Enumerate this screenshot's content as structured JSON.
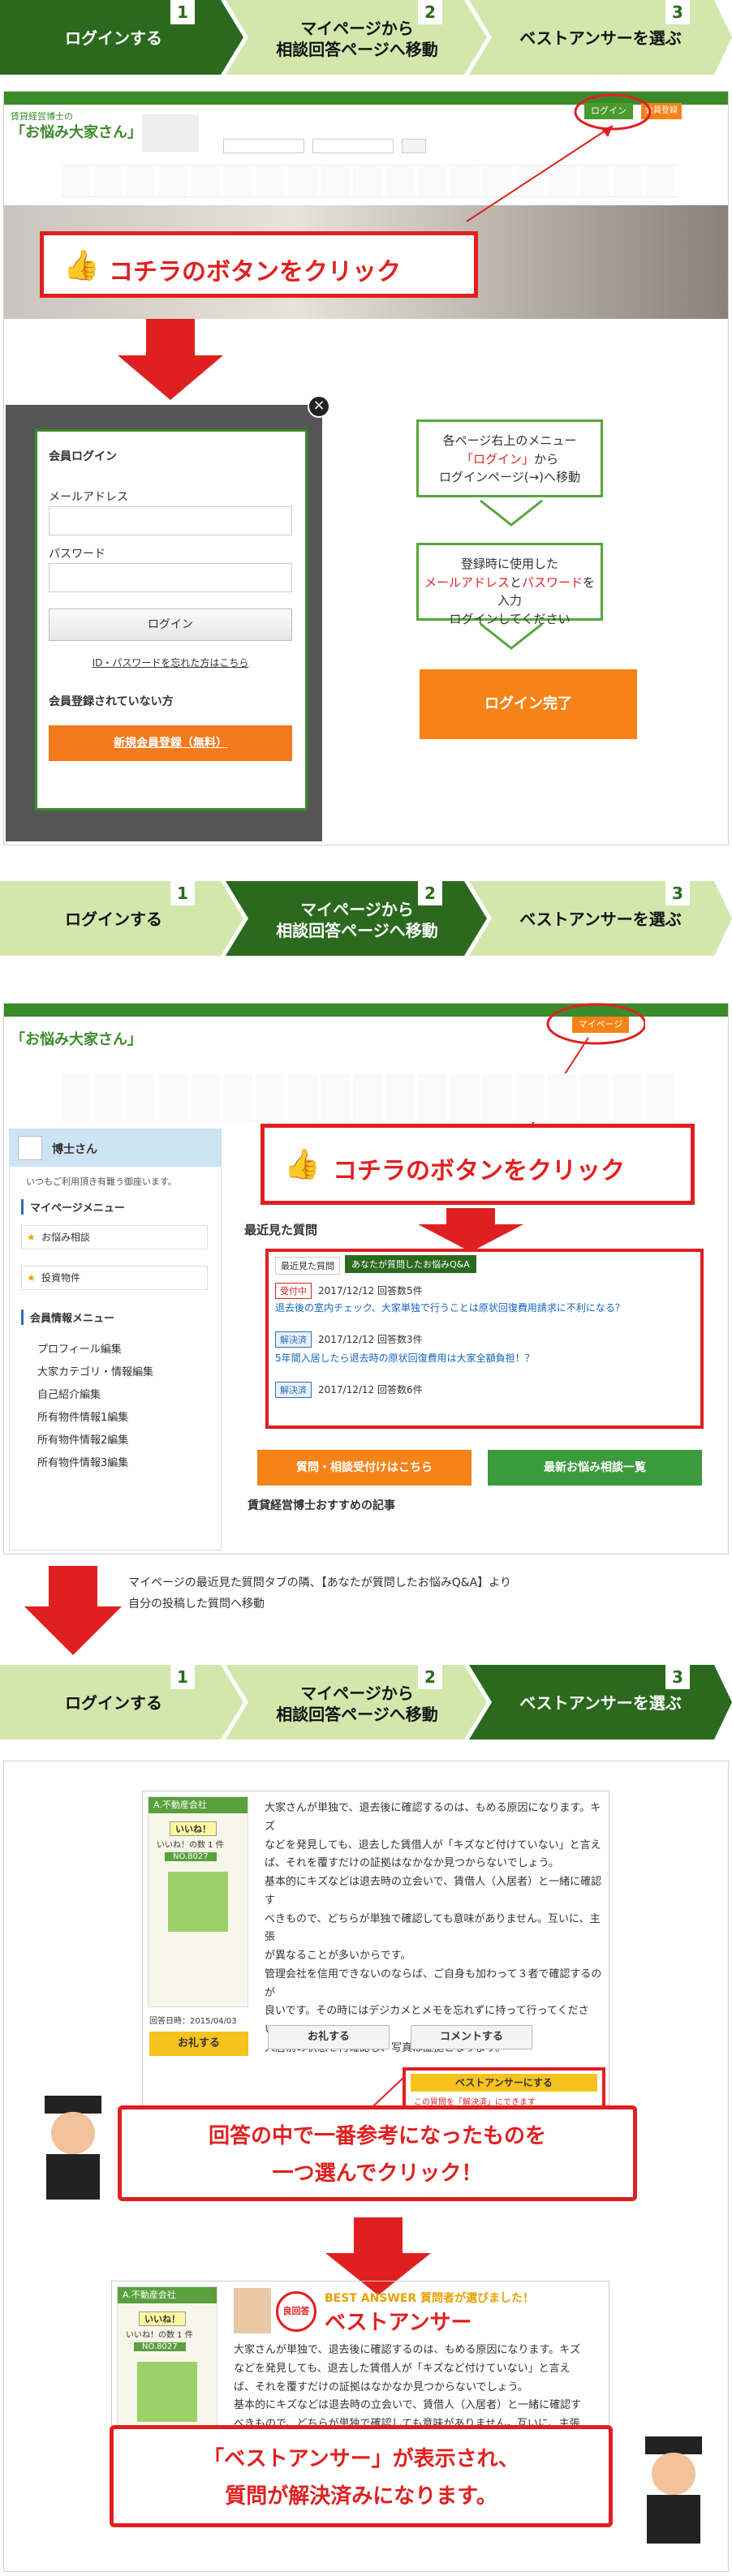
{
  "steps": {
    "step1": "ログインする",
    "step2": "マイページから\n相談回答ページへ移動",
    "step3": "ベストアンサーを選ぶ",
    "n1": "1",
    "n2": "2",
    "n3": "3"
  },
  "colors": {
    "stepActive": "#2b6a1e",
    "stepInactive": "#d3e7ad",
    "red": "#e02020",
    "orange": "#f58318",
    "green": "#56a73d"
  },
  "section1": {
    "site_logo_small": "賃貸経営博士の",
    "site_logo_big": "「お悩み大家さん」",
    "login_btn": "ログイン",
    "register_btn": "会員登録",
    "callout": "コチラのボタンをクリック",
    "modal": {
      "title": "会員ログイン",
      "email_label": "メールアドレス",
      "password_label": "パスワード",
      "login_button": "ログイン",
      "forgot_link": "ID・パスワードを忘れた方はこちら",
      "not_registered": "会員登録されていない方",
      "register_button": "新規会員登録（無料）"
    },
    "step_a_1": "各ページ右上のメニュー",
    "step_a_2": "「ログイン」",
    "step_a_3": "から",
    "step_a_4": "ログインページ(→)へ移動",
    "step_b_1": "登録時に使用した",
    "step_b_2": "メールアドレス",
    "step_b_3": "と",
    "step_b_4": "パスワード",
    "step_b_5": "を入力",
    "step_b_6": "ログインしてください",
    "done": "ログイン完了"
  },
  "section2": {
    "mypage_btn": "マイページ",
    "user_name": "博士さん",
    "welcome": "いつもご利用頂き有難う御座います。",
    "menu_title": "マイページメニュー",
    "menu_items": [
      "お悩み相談",
      "投資物件"
    ],
    "member_title": "会員情報メニュー",
    "member_items": [
      "プロフィール編集",
      "大家カテゴリ・情報編集",
      "自己紹介編集",
      "所有物件情報1編集",
      "所有物件情報2編集",
      "所有物件情報3編集"
    ],
    "callout": "コチラのボタンをクリック",
    "recent_title": "最近見た質問",
    "tab1": "最近見た質問",
    "tab2": "あなたが質問したお悩みQ&A",
    "q1_badge": "受付中",
    "q1_meta": "2017/12/12  回答数5件",
    "q1_text": "退去後の室内チェック、大家単独で行うことは原状回復費用請求に不利になる？",
    "q2_badge": "解決済",
    "q2_meta": "2017/12/12  回答数3件",
    "q2_text": "5年間入居したら退去時の原状回復費用は大家全額負担！？",
    "q3_badge": "解決済",
    "q3_meta": "2017/12/12  回答数6件",
    "btn_ask": "質問・相談受付けはこちら",
    "btn_latest": "最新お悩み相談一覧",
    "recommend": "賃貸経営博士おすすめの記事",
    "note_1": "マイページの最近見た質問タブの隣、【あなたが質問したお悩みQ&A】より",
    "note_2": "自分の投稿した質問へ移動"
  },
  "section3": {
    "company": "A.不動産会社",
    "iine_badge": "いいね！",
    "iine_count": "いいね！の数 1 件",
    "no": "NO.8027",
    "answer_date": "回答日時：2015/04/03",
    "thanks_btn": "お礼する",
    "thanks_btn2": "お礼する",
    "comment_btn": "コメントする",
    "best_btn": "ベストアンサーにする",
    "best_note": "この質問を「解決済」にできます",
    "answer": [
      "大家さんが単独で、退去後に確認するのは、もめる原因になります。キズ",
      "などを発見しても、退去した賃借人が「キズなど付けていない」と言え",
      "ば、それを覆すだけの証拠はなかなか見つからないでしょう。",
      "基本的にキズなどは退去時の立会いで、賃借人（入居者）と一緒に確認す",
      "べきもので、どちらが単独で確認しても意味がありません。互いに、主張",
      "が異なることが多いからです。",
      "管理会社を信用できないのならば、ご自身も加わって３者で確認するのが",
      "良いです。その時にはデジカメとメモを忘れずに持って行ってください。",
      "入居前の状態を再確認し、写真は証拠となります。"
    ],
    "callout_1": "回答の中で一番参考になったものを",
    "callout_2": "一つ選んでクリック！",
    "best_small": "BEST ANSWER 質問者が選びました！",
    "best_big": "ベストアンサー",
    "best_stamp": "良回答",
    "answer2": [
      "大家さんが単独で、退去後に確認するのは、もめる原因になります。キズ",
      "などを発見しても、退去した賃借人が「キズなど付けていない」と言え",
      "ば、それを覆すだけの証拠はなかなか見つからないでしょう。",
      "基本的にキズなどは退去時の立会いで、賃借人（入居者）と一緒に確認す",
      "べきもので、どちらが単独で確認しても意味がありません。互いに、主張"
    ],
    "final_1": "「ベストアンサー」が表示され、",
    "final_2": "質問が解決済みになります。"
  }
}
